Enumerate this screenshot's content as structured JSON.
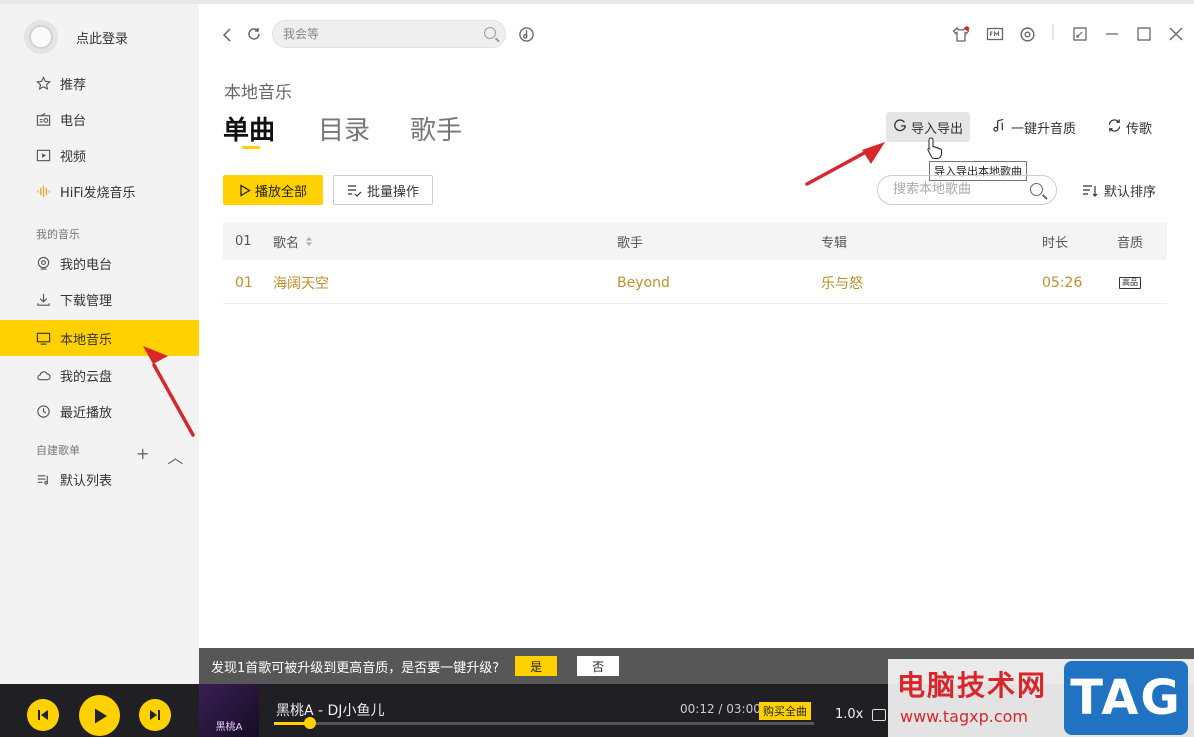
{
  "sidebar": {
    "login_text": "点此登录",
    "items": [
      {
        "label": "推荐",
        "icon": "star-icon"
      },
      {
        "label": "电台",
        "icon": "radio-icon"
      },
      {
        "label": "视频",
        "icon": "video-icon"
      },
      {
        "label": "HiFi发烧音乐",
        "icon": "hifi-wave-icon"
      }
    ],
    "my_music_title": "我的音乐",
    "my_music": [
      {
        "label": "我的电台",
        "icon": "my-radio-icon"
      },
      {
        "label": "下载管理",
        "icon": "download-icon"
      },
      {
        "label": "本地音乐",
        "icon": "local-music-icon",
        "active": true
      },
      {
        "label": "我的云盘",
        "icon": "cloud-icon"
      },
      {
        "label": "最近播放",
        "icon": "clock-icon"
      }
    ],
    "playlists_title": "自建歌单",
    "playlists": [
      {
        "label": "默认列表",
        "icon": "playlist-icon"
      }
    ],
    "add_symbol": "+",
    "collapse_symbol": "︿"
  },
  "topbar": {
    "search_placeholder": "我会等"
  },
  "page": {
    "subtitle": "本地音乐",
    "tabs": [
      "单曲",
      "目录",
      "歌手"
    ],
    "actions": {
      "import_export": "导入导出",
      "upgrade_quality": "一键升音质",
      "transfer": "传歌"
    },
    "tooltip": "导入导出本地歌曲",
    "play_all": "播放全部",
    "batch": "批量操作",
    "search_placeholder": "搜索本地歌曲",
    "sort": "默认排序"
  },
  "table": {
    "headers": {
      "index": "01",
      "name": "歌名",
      "artist": "歌手",
      "album": "专辑",
      "duration": "时长",
      "quality": "音质"
    },
    "rows": [
      {
        "index": "01",
        "name": "海阔天空",
        "artist": "Beyond",
        "album": "乐与怒",
        "duration": "05:26",
        "quality": "高品"
      }
    ]
  },
  "upgrade_bar": {
    "text": "发现1首歌可被升级到更高音质，是否要一键升级?",
    "yes": "是",
    "no": "否"
  },
  "player": {
    "cover_text": "黑桃A",
    "track": "黑桃A - DJ小鱼儿",
    "time": "00:12 / 03:00",
    "progress": 0.067,
    "buy": "购买全曲",
    "speed": "1.0x"
  },
  "watermark": {
    "title": "电脑技术网",
    "url": "www.tagxp.com",
    "tag": "TAG"
  },
  "colors": {
    "accent": "#ffd100",
    "song_text": "#c0902a",
    "arrow": "#d8262a"
  }
}
